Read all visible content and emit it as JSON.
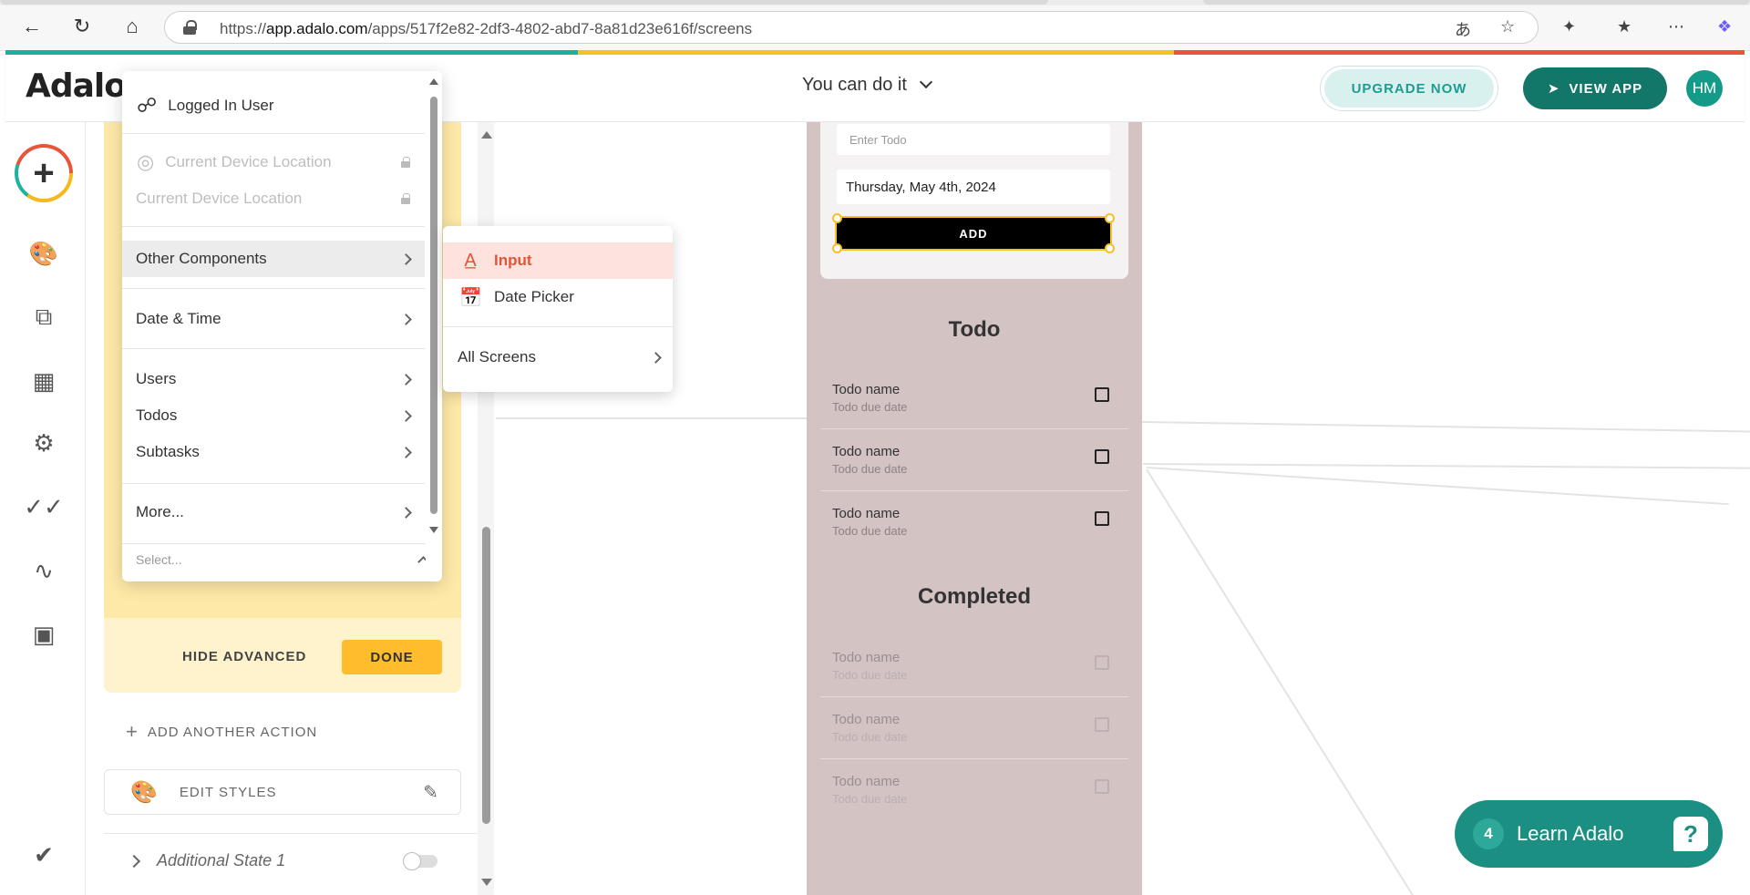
{
  "browser": {
    "url_prefix": "https://",
    "url_host": "app.adalo.com",
    "url_path": "/apps/517f2e82-2df3-4802-abd7-8a81d23e616f/screens"
  },
  "header": {
    "logo": "Adalo",
    "app_name": "You can do it",
    "upgrade_label": "UPGRADE NOW",
    "view_app_label": "VIEW APP",
    "avatar_initials": "HM"
  },
  "stripe_colors": [
    "#1fae9c",
    "#f6c026",
    "#e9553b"
  ],
  "panel": {
    "hide_advanced": "HIDE ADVANCED",
    "done": "DONE",
    "add_action": "ADD ANOTHER ACTION",
    "edit_styles": "EDIT STYLES",
    "additional_state": "Additional State 1"
  },
  "dropdown": {
    "logged_in_user": "Logged In User",
    "current_device_location_1": "Current Device Location",
    "current_device_location_2": "Current Device Location",
    "other_components": "Other Components",
    "date_time": "Date & Time",
    "users": "Users",
    "todos": "Todos",
    "subtasks": "Subtasks",
    "more": "More...",
    "select_placeholder": "Select..."
  },
  "submenu": {
    "input": "Input",
    "date_picker": "Date Picker",
    "all_screens": "All Screens"
  },
  "phone": {
    "enter_todo_placeholder": "Enter Todo",
    "date_value": "Thursday, May 4th, 2024",
    "add_button": "ADD",
    "todo_title": "Todo",
    "completed_title": "Completed",
    "todo_items": [
      {
        "name": "Todo name",
        "due": "Todo due date"
      },
      {
        "name": "Todo name",
        "due": "Todo due date"
      },
      {
        "name": "Todo name",
        "due": "Todo due date"
      }
    ],
    "completed_items": [
      {
        "name": "Todo name",
        "due": "Todo due date"
      },
      {
        "name": "Todo name",
        "due": "Todo due date"
      },
      {
        "name": "Todo name",
        "due": "Todo due date"
      }
    ]
  },
  "learn": {
    "badge": "4",
    "label": "Learn Adalo"
  }
}
